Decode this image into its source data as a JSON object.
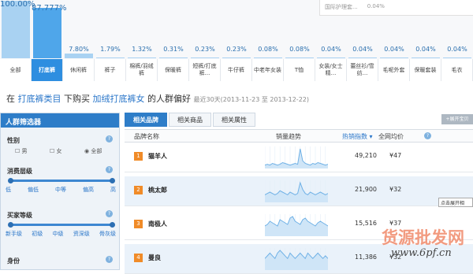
{
  "top_chart": {
    "bars": [
      {
        "pct": "100.00%",
        "value": 100.0,
        "label": "全部",
        "selected": false
      },
      {
        "pct": "87.777%",
        "value": 87.777,
        "label": "打底裤",
        "selected": true
      },
      {
        "pct": "7.80%",
        "value": 7.8,
        "label": "休闲裤",
        "selected": false
      },
      {
        "pct": "1.79%",
        "value": 1.79,
        "label": "裤子",
        "selected": false
      },
      {
        "pct": "1.32%",
        "value": 1.32,
        "label": "棉裤/羽绒裤",
        "selected": false
      },
      {
        "pct": "0.31%",
        "value": 0.31,
        "label": "保暖裤",
        "selected": false
      },
      {
        "pct": "0.23%",
        "value": 0.23,
        "label": "短裤/打底裤...",
        "selected": false
      },
      {
        "pct": "0.23%",
        "value": 0.23,
        "label": "牛仔裤",
        "selected": false
      },
      {
        "pct": "0.08%",
        "value": 0.08,
        "label": "中老年女装",
        "selected": false
      },
      {
        "pct": "0.08%",
        "value": 0.08,
        "label": "T恤",
        "selected": false
      },
      {
        "pct": "0.04%",
        "value": 0.04,
        "label": "女装/女士精...",
        "selected": false
      },
      {
        "pct": "0.04%",
        "value": 0.04,
        "label": "蕾丝衫/雪纺...",
        "selected": false
      },
      {
        "pct": "0.04%",
        "value": 0.04,
        "label": "毛呢外套",
        "selected": false
      },
      {
        "pct": "0.04%",
        "value": 0.04,
        "label": "保暖套装",
        "selected": false
      },
      {
        "pct": "0.04%",
        "value": 0.04,
        "label": "毛衣",
        "selected": false
      }
    ],
    "tooltip_row": {
      "label": "国际护理套...",
      "value": "0.04%"
    }
  },
  "headline": {
    "p1": "在",
    "cat": "打底裤类目",
    "p2": "下购买",
    "product": "加绒打底裤女",
    "p3": "的人群偏好",
    "date": "最近30天(2013-11-23 至 2013-12-22)"
  },
  "sidebar": {
    "title": "人群筛选器",
    "gender": {
      "label": "性别",
      "options": [
        "男",
        "女",
        "全部"
      ],
      "selected": "全部"
    },
    "consumption": {
      "label": "消费层级",
      "ticks": [
        "低",
        "偏低",
        "中等",
        "偏高",
        "高"
      ]
    },
    "buyer_level": {
      "label": "买家等级",
      "ticks": [
        "新手级",
        "初级",
        "中级",
        "资深级",
        "骨灰级"
      ]
    },
    "identity": {
      "label": "身份"
    }
  },
  "main": {
    "tabs": [
      "相关品牌",
      "相关商品",
      "相关属性"
    ],
    "expand_label": "+展开宝贝",
    "headers": {
      "name": "品牌名称",
      "trend": "销量趋势",
      "index": "热销指数",
      "price": "全网均价"
    },
    "rows": [
      {
        "rank": "1",
        "name": "猫羊人",
        "index": "49,210",
        "price": "¥47",
        "trend": [
          3,
          4,
          3,
          5,
          4,
          3,
          4,
          6,
          5,
          4,
          3,
          4,
          5,
          4,
          22,
          8,
          5,
          4,
          3,
          5,
          4,
          6,
          5,
          4,
          3,
          4
        ]
      },
      {
        "rank": "2",
        "name": "桃太郎",
        "index": "21,900",
        "price": "¥32",
        "trend": [
          5,
          6,
          7,
          6,
          5,
          6,
          8,
          7,
          6,
          5,
          7,
          6,
          5,
          6,
          14,
          9,
          6,
          5,
          7,
          6,
          5,
          6,
          7,
          6,
          5,
          6
        ]
      },
      {
        "rank": "3",
        "name": "南极人",
        "index": "15,516",
        "price": "¥37",
        "trend": [
          6,
          7,
          9,
          8,
          7,
          6,
          10,
          9,
          8,
          7,
          11,
          12,
          9,
          8,
          7,
          10,
          11,
          9,
          8,
          7,
          6,
          8,
          9,
          8,
          7,
          6
        ]
      },
      {
        "rank": "4",
        "name": "曼良",
        "index": "11,386",
        "price": "¥32",
        "trend": [
          4,
          5,
          6,
          5,
          4,
          6,
          7,
          6,
          5,
          4,
          6,
          5,
          4,
          5,
          6,
          5,
          4,
          6,
          5,
          4,
          5,
          6,
          5,
          4,
          5,
          4
        ]
      }
    ],
    "tooltip": "点击展开相"
  },
  "watermark": {
    "line1": "货源批发网",
    "line2": "www.6pf.cn"
  },
  "colors": {
    "accent": "#2e7dc8",
    "bar": "#a9d2f2",
    "bar_selected": "#4fa6ea",
    "rank": "#f08b28"
  }
}
